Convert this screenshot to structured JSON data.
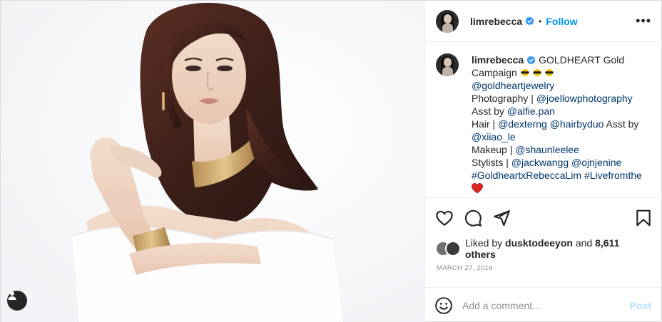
{
  "post": {
    "username": "limrebecca",
    "follow_label": "Follow",
    "more_label": "•••"
  },
  "caption": {
    "username": "limrebecca",
    "lines": [
      "GOLDHEART Gold",
      "Campaign",
      "@goldheartjewelry",
      "Photography |",
      "@joellowphotography",
      "Asst by",
      "@alfie.pan",
      "Hair |",
      "@dexterng",
      "@hairbyduo",
      "Asst by",
      "@xiiao_le",
      "Makeup |",
      "@shaunleelee",
      "Stylists |",
      "@jackwangg",
      "@ojnjenine",
      "#GoldheartxRebeccaLim",
      "#Livefromthe"
    ]
  },
  "likes": {
    "prefix": "Liked by",
    "user": "dusktodeeyon",
    "middle": "and",
    "count": "8,611 others"
  },
  "date": "March 27, 2016",
  "comment": {
    "placeholder": "Add a comment...",
    "post_label": "Post"
  },
  "icons": {
    "like": "heart-outline-icon",
    "comment": "comment-bubble-icon",
    "share": "paper-plane-icon",
    "save": "bookmark-icon",
    "emoji": "smiley-icon",
    "tag": "user-tag-icon"
  },
  "colors": {
    "link": "#0095f6",
    "mention": "#00376b",
    "muted": "#8e8e8e",
    "post_disabled": "#b2dffc",
    "verified": "#3897f0"
  }
}
